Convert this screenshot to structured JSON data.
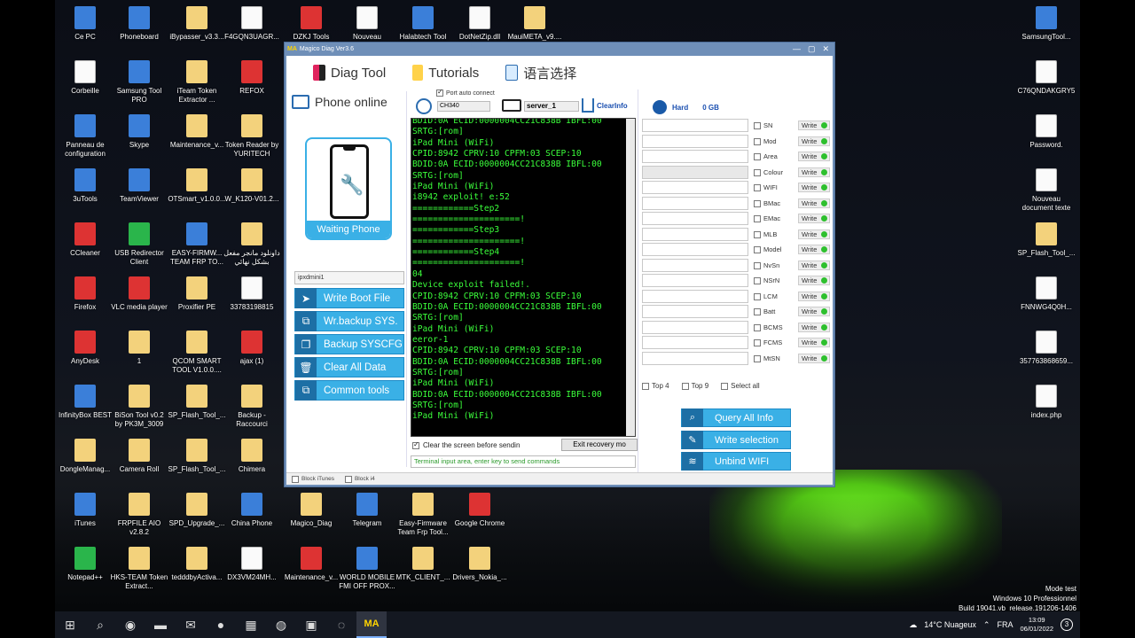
{
  "desktop_icons": [
    {
      "label": "Ce PC",
      "kind": "app"
    },
    {
      "label": "Phoneboard",
      "kind": "app"
    },
    {
      "label": "iBypasser_v3.3...",
      "kind": "folder"
    },
    {
      "label": "F4GQN3UAGR...",
      "kind": "file"
    },
    {
      "label": "DZKJ Tools",
      "kind": "red"
    },
    {
      "label": "Nouveau",
      "kind": "file"
    },
    {
      "label": "Halabtech Tool",
      "kind": "app"
    },
    {
      "label": "DotNetZip.dll",
      "kind": "file"
    },
    {
      "label": "MauiMETA_v9....",
      "kind": "folder"
    },
    {
      "label": "Corbeille",
      "kind": "file"
    },
    {
      "label": "Samsung Tool PRO",
      "kind": "app"
    },
    {
      "label": "iTeam Token Extractor ...",
      "kind": "folder"
    },
    {
      "label": "REFOX",
      "kind": "red"
    },
    {
      "label": "Panneau de configuration",
      "kind": "app"
    },
    {
      "label": "Skype",
      "kind": "app"
    },
    {
      "label": "Maintenance_v...",
      "kind": "folder"
    },
    {
      "label": "Token Reader by YURITECH",
      "kind": "folder"
    },
    {
      "label": "3uTools",
      "kind": "app"
    },
    {
      "label": "TeamViewer",
      "kind": "app"
    },
    {
      "label": "OTSmart_v1.0.0...",
      "kind": "folder"
    },
    {
      "label": "W_K120-V01.2...",
      "kind": "folder"
    },
    {
      "label": "CCleaner",
      "kind": "red"
    },
    {
      "label": "USB Redirector Client",
      "kind": "green"
    },
    {
      "label": "EASY-FIRMW... TEAM FRP TO...",
      "kind": "app"
    },
    {
      "label": "داونلود مانجر مفعل بشكل نهائي",
      "kind": "folder"
    },
    {
      "label": "Firefox",
      "kind": "red"
    },
    {
      "label": "VLC media player",
      "kind": "red"
    },
    {
      "label": "Proxifier PE",
      "kind": "folder"
    },
    {
      "label": "33783198815",
      "kind": "file"
    },
    {
      "label": "AnyDesk",
      "kind": "red"
    },
    {
      "label": "1",
      "kind": "folder"
    },
    {
      "label": "QCOM SMART TOOL V1.0.0....",
      "kind": "folder"
    },
    {
      "label": "ajax (1)",
      "kind": "red"
    },
    {
      "label": "InfinityBox BEST",
      "kind": "app"
    },
    {
      "label": "BiSon Tool v0.2 by PK3M_3009",
      "kind": "folder"
    },
    {
      "label": "SP_Flash_Tool_...",
      "kind": "folder"
    },
    {
      "label": "Backup - Raccourci",
      "kind": "folder"
    },
    {
      "label": "DongleManag...",
      "kind": "folder"
    },
    {
      "label": "Camera Roll",
      "kind": "folder"
    },
    {
      "label": "SP_Flash_Tool_...",
      "kind": "folder"
    },
    {
      "label": "Chimera",
      "kind": "folder"
    },
    {
      "label": "iTunes",
      "kind": "app"
    },
    {
      "label": "FRPFILE AIO v2.8.2",
      "kind": "folder"
    },
    {
      "label": "SPD_Upgrade_...",
      "kind": "folder"
    },
    {
      "label": "China Phone",
      "kind": "app"
    },
    {
      "label": "Magico_Diag",
      "kind": "folder"
    },
    {
      "label": "Telegram",
      "kind": "app"
    },
    {
      "label": "Easy-Firmware Team Frp Tool...",
      "kind": "folder"
    },
    {
      "label": "Google Chrome",
      "kind": "red"
    },
    {
      "label": "Notepad++",
      "kind": "green"
    },
    {
      "label": "HKS-TEAM Token Extract...",
      "kind": "folder"
    },
    {
      "label": "tedddbyActiva...",
      "kind": "folder"
    },
    {
      "label": "DX3VM24MH...",
      "kind": "file"
    },
    {
      "label": "Maintenance_v...",
      "kind": "red"
    },
    {
      "label": "WORLD MOBILE FMI OFF PROX...",
      "kind": "app"
    },
    {
      "label": "MTK_CLIENT_...",
      "kind": "folder"
    },
    {
      "label": "Drivers_Nokia_...",
      "kind": "folder"
    },
    {
      "label": "SamsungTool...",
      "kind": "app"
    },
    {
      "label": "C76QNDAKGRY5",
      "kind": "file"
    },
    {
      "label": "Password.",
      "kind": "file"
    },
    {
      "label": "Nouveau document texte",
      "kind": "file"
    },
    {
      "label": "SP_Flash_Tool_...",
      "kind": "folder"
    },
    {
      "label": "FNNWG4Q0H...",
      "kind": "file"
    },
    {
      "label": "357763868659...",
      "kind": "file"
    },
    {
      "label": "index.php",
      "kind": "file"
    }
  ],
  "window": {
    "title_logo": "MA",
    "title": "Magico Diag Ver3.6",
    "min": "—",
    "max": "▢",
    "close": "✕"
  },
  "menu": {
    "diag_tool": "Diag Tool",
    "tutorials": "Tutorials",
    "language": "语言选择"
  },
  "left": {
    "phone_status": "Phone online",
    "waiting": "Waiting Phone",
    "model_select": "ipxdmini1",
    "buttons": [
      "Write Boot File",
      "Wr.backup SYS.",
      "Backup SYSCFG",
      "Clear All Data",
      "Common tools"
    ]
  },
  "center": {
    "port_auto": "Port auto connect",
    "channel": "CH340",
    "server": "server_1",
    "clear_info": "ClearInfo",
    "terminal_lines": [
      "BDID:0A ECID:0000004CC21C838B IBFL:00",
      "SRTG:[rom]",
      "iPad Mini (WiFi)",
      "CPID:8942 CPRV:10 CPFM:03 SCEP:10",
      "BDID:0A ECID:0000004CC21C838B IBFL:00",
      "SRTG:[rom]",
      "iPad Mini (WiFi)",
      "i8942 exploit! e:52",
      "============Step2",
      "=====================!",
      "============Step3",
      "=====================!",
      "============Step4",
      "=====================!",
      "04",
      "Device exploit failed!.",
      "CPID:8942 CPRV:10 CPFM:03 SCEP:10",
      "BDID:0A ECID:0000004CC21C838B IBFL:00",
      "SRTG:[rom]",
      "iPad Mini (WiFi)",
      "eeror-1",
      "CPID:8942 CPRV:10 CPFM:03 SCEP:10",
      "BDID:0A ECID:0000004CC21C838B IBFL:00",
      "SRTG:[rom]",
      "iPad Mini (WiFi)",
      "BDID:0A ECID:0000004CC21C838B IBFL:00",
      "SRTG:[rom]",
      "iPad Mini (WiFi)"
    ],
    "clear_screen": "Clear the screen before sendin",
    "exit_recovery": "Exit recovery mo",
    "input_placeholder": "Terminal input area, enter key to send commands"
  },
  "right": {
    "hard_label": "Hard",
    "hard_value": "0 GB",
    "fields": [
      "SN",
      "Mod",
      "Area",
      "Colour",
      "WIFI",
      "BMac",
      "EMac",
      "MLB",
      "Model",
      "NvSn",
      "NSrN",
      "LCM",
      "Batt",
      "BCMS",
      "FCMS",
      "MtSN"
    ],
    "write_label": "Write",
    "top4": "Top 4",
    "top9": "Top 9",
    "select_all": "Select all",
    "buttons": [
      "Query All Info",
      "Write selection",
      "Unbind WIFI"
    ]
  },
  "statusbar": {
    "block_itunes": "Block iTunes",
    "block_i4": "Block i4"
  },
  "watermark": {
    "line1": "Mode test",
    "line2": "Windows 10 Professionnel",
    "line3": "Build 19041.vb_release.191206-1406"
  },
  "taskbar": {
    "weather": "14°C  Nuageux",
    "lang": "FRA",
    "time": "13:09",
    "date": "06/01/2022",
    "badge": "3",
    "active_app": "MA"
  },
  "colors": {
    "accent": "#3ab0e6",
    "terminal_text": "#3bff3b",
    "tent_glow": "#7cff2c"
  }
}
